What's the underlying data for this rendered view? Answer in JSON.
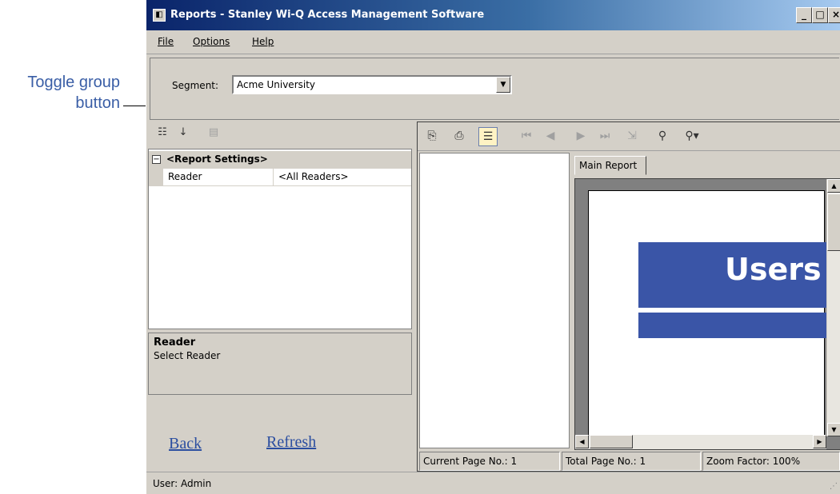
{
  "annotation": {
    "line1": "Toggle group",
    "line2": "button"
  },
  "window": {
    "title": "Reports - Stanley Wi-Q Access Management Software",
    "controls": {
      "minimize": "_",
      "maximize": "□",
      "close": "×"
    }
  },
  "menu": {
    "file": "File",
    "options": "Options",
    "help": "Help"
  },
  "segment": {
    "label": "Segment:",
    "value": "Acme University"
  },
  "property_grid": {
    "category": "<Report Settings>",
    "rows": [
      {
        "name": "Reader",
        "value": "<All Readers>"
      }
    ],
    "help_title": "Reader",
    "help_desc": "Select Reader"
  },
  "links": {
    "back": "Back",
    "refresh": "Refresh"
  },
  "viewer": {
    "tab": "Main Report",
    "banner_text": "Users"
  },
  "status": {
    "current_page": "Current Page No.: 1",
    "total_page": "Total Page No.: 1",
    "zoom": "Zoom Factor: 100%"
  },
  "footer": {
    "user": "User: Admin"
  },
  "colors": {
    "accent": "#3a55a7",
    "link": "#2b4ea0",
    "annotation": "#3a5ea6"
  },
  "icons": {
    "toolbar_left": [
      "categorized-icon",
      "alphabetical-sort-icon",
      "property-pages-icon"
    ],
    "toolbar_viewer": [
      "export-icon",
      "print-icon",
      "toggle-group-tree-icon",
      "first-page-icon",
      "previous-page-icon",
      "next-page-icon",
      "last-page-icon",
      "go-to-page-icon",
      "search-icon",
      "zoom-icon"
    ]
  }
}
